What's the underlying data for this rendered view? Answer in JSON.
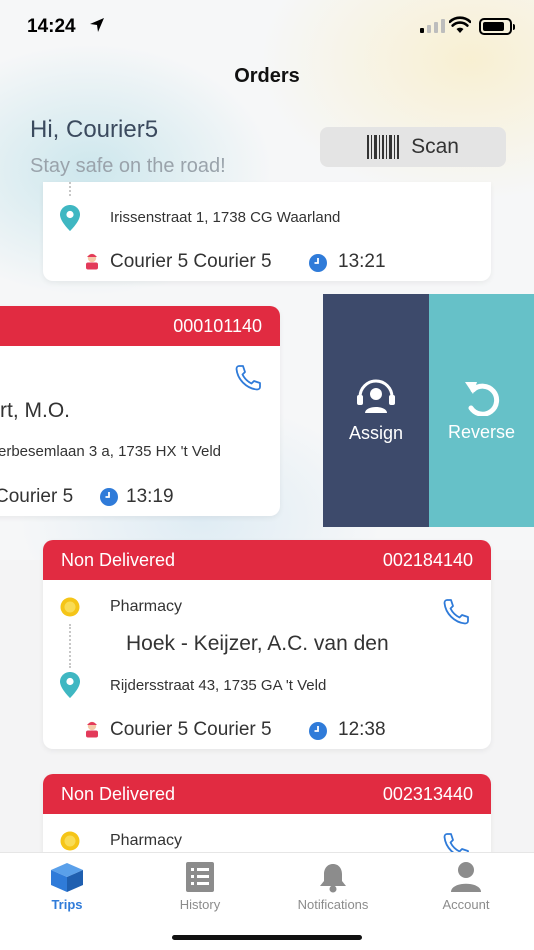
{
  "status_bar": {
    "time": "14:24"
  },
  "header": {
    "title": "Orders"
  },
  "greeting": {
    "hello": "Hi, Courier5",
    "subtitle": "Stay safe on the road!"
  },
  "scan": {
    "label": "Scan"
  },
  "cards": [
    {
      "address": "Irissenstraat 1, 1738 CG Waarland",
      "courier": "Courier 5 Courier 5",
      "time": "13:21"
    },
    {
      "order_no": "000101140",
      "name": "rt, M.O.",
      "address": "erbesemlaan 3 a, 1735 HX 't Veld",
      "courier": "Courier 5",
      "time": "13:19"
    },
    {
      "status": "Non Delivered",
      "order_no": "002184140",
      "pharmacy": "Pharmacy",
      "name": "Hoek - Keijzer, A.C. van den",
      "address": "Rijdersstraat 43, 1735 GA 't Veld",
      "courier": "Courier 5 Courier 5",
      "time": "12:38"
    },
    {
      "status": "Non Delivered",
      "order_no": "002313440",
      "pharmacy": "Pharmacy"
    }
  ],
  "swipe_actions": {
    "assign": "Assign",
    "reverse": "Reverse"
  },
  "tabs": [
    {
      "label": "Trips",
      "icon": "box-icon",
      "active": true
    },
    {
      "label": "History",
      "icon": "list-icon",
      "active": false
    },
    {
      "label": "Notifications",
      "icon": "bell-icon",
      "active": false
    },
    {
      "label": "Account",
      "icon": "user-icon",
      "active": false
    }
  ],
  "colors": {
    "header_red": "#e12b41",
    "assign_bg": "#3d4a6b",
    "reverse_bg": "#66c1c8",
    "accent_blue": "#2f7bd9",
    "pin_teal": "#3fb7c2",
    "pharmacy_yellow": "#f5c518"
  }
}
